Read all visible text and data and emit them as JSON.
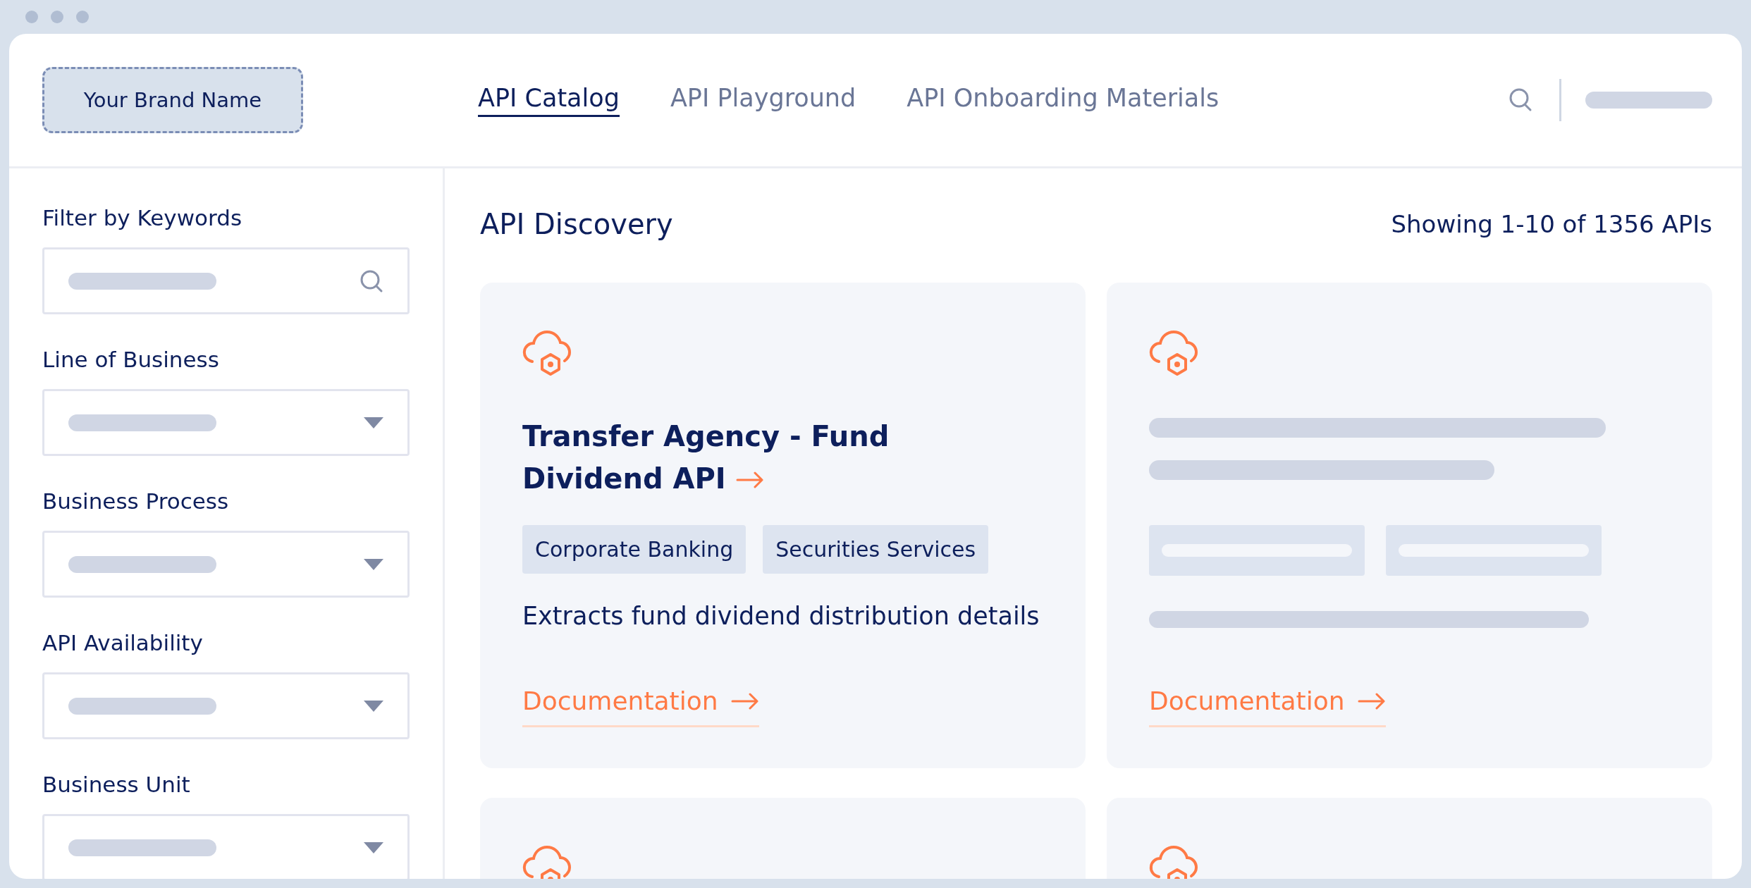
{
  "brand": {
    "label": "Your Brand Name"
  },
  "nav": [
    {
      "label": "API Catalog",
      "selected": true
    },
    {
      "label": "API Playground",
      "selected": false
    },
    {
      "label": "API Onboarding Materials",
      "selected": false
    }
  ],
  "filters": [
    {
      "label": "Filter by Keywords",
      "kind": "search"
    },
    {
      "label": "Line of Business",
      "kind": "dropdown"
    },
    {
      "label": "Business Process",
      "kind": "dropdown"
    },
    {
      "label": "API Availability",
      "kind": "dropdown"
    },
    {
      "label": "Business Unit",
      "kind": "dropdown"
    }
  ],
  "main": {
    "title": "API Discovery",
    "count": "Showing 1-10 of 1356 APIs"
  },
  "cards": [
    {
      "kind": "api",
      "title": "Transfer Agency - Fund Dividend API",
      "tags": [
        "Corporate Banking",
        "Securities Services"
      ],
      "description": "Extracts fund dividend distribution details",
      "link": "Documentation"
    },
    {
      "kind": "skeleton",
      "link": "Documentation"
    },
    {
      "kind": "partial"
    },
    {
      "kind": "partial"
    }
  ]
}
